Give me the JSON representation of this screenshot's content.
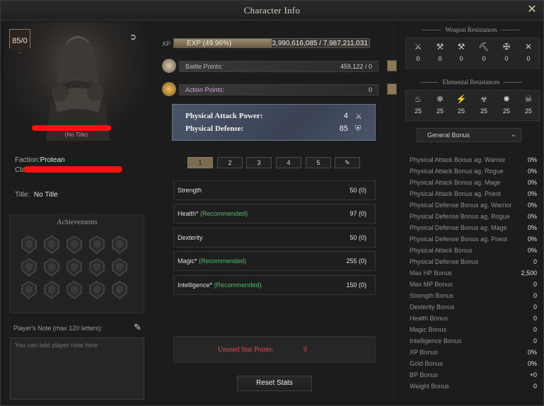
{
  "window": {
    "title": "Character Info"
  },
  "character": {
    "level": "85/0",
    "no_title": "(No Title)",
    "faction_label": "Faction:",
    "faction_value": "Protean",
    "clan_label": "Clan:",
    "title_label": "Title:",
    "title_value": "No Title"
  },
  "achievements": {
    "label": "Achievements",
    "count": 15
  },
  "note": {
    "label": "Player's Note (max 120 letters):",
    "placeholder": "You can add player note here"
  },
  "xp": {
    "label": "XP",
    "percent_label": "EXP (49.96%)",
    "value": "3,990,616,085 / 7,987,211,031",
    "fraction": 0.4996
  },
  "points": [
    {
      "label": "Battle Points:",
      "value": "459,122 / 0",
      "color": "#b8b8b8"
    },
    {
      "label": "Action Points:",
      "value": "0",
      "color": "#c8a4d8"
    }
  ],
  "power": [
    {
      "label": "Physical Attack Power:",
      "value": "4"
    },
    {
      "label": "Physical Defense:",
      "value": "85"
    }
  ],
  "tabs": [
    "1",
    "2",
    "3",
    "4",
    "5"
  ],
  "stats": [
    {
      "name": "Strength",
      "rec": "",
      "value": "50 (0)"
    },
    {
      "name": "Health*",
      "rec": "(Recommended)",
      "value": "97 (0)"
    },
    {
      "name": "Dexterity",
      "rec": "",
      "value": "50 (0)"
    },
    {
      "name": "Magic*",
      "rec": "(Recommended)",
      "value": "255 (0)"
    },
    {
      "name": "Intelligence*",
      "rec": "(Recommended)",
      "value": "150 (0)"
    }
  ],
  "unused": {
    "label": "Unused Stat Points:",
    "value": "0"
  },
  "reset_label": "Reset Stats",
  "weapon_resistances": {
    "title": "Weapon Resistances",
    "items": [
      {
        "icon": "crossed-swords-icon",
        "value": "0"
      },
      {
        "icon": "crossed-axes-icon",
        "value": "0"
      },
      {
        "icon": "hammer-icon",
        "value": "0"
      },
      {
        "icon": "crossed-picks-icon",
        "value": "0"
      },
      {
        "icon": "crossed-spears-icon",
        "value": "0"
      },
      {
        "icon": "crossed-daggers-icon",
        "value": "0"
      }
    ]
  },
  "elemental_resistances": {
    "title": "Elemental Resistances",
    "items": [
      {
        "icon": "fire-icon",
        "value": "25"
      },
      {
        "icon": "frost-icon",
        "value": "25"
      },
      {
        "icon": "lightning-icon",
        "value": "25"
      },
      {
        "icon": "poison-icon",
        "value": "25"
      },
      {
        "icon": "holy-icon",
        "value": "25"
      },
      {
        "icon": "dark-icon",
        "value": "25"
      }
    ]
  },
  "bonus": {
    "dropdown": "General Bonus",
    "rows": [
      {
        "label": "Physical Attack Bonus ag. Warrior",
        "value": "0%"
      },
      {
        "label": "Physical Attack Bonus ag. Rogue",
        "value": "0%"
      },
      {
        "label": "Physical Attack Bonus ag. Mage",
        "value": "0%"
      },
      {
        "label": "Physical Attack Bonus ag. Priest",
        "value": "0%"
      },
      {
        "label": "Physical Defense Bonus ag. Warrior",
        "value": "0%"
      },
      {
        "label": "Physical Defense Bonus ag. Rogue",
        "value": "0%"
      },
      {
        "label": "Physical Defense Bonus ag. Mage",
        "value": "0%"
      },
      {
        "label": "Physical Defense Bonus ag. Priest",
        "value": "0%"
      },
      {
        "label": "Physical Attack Bonus",
        "value": "0%"
      },
      {
        "label": "Physical Defense Bonus",
        "value": "0"
      },
      {
        "label": "Max HP Bonus",
        "value": "2,500"
      },
      {
        "label": "Max MP Bonus",
        "value": "0"
      },
      {
        "label": "Strength Bonus",
        "value": "0"
      },
      {
        "label": "Dexterity Bonus",
        "value": "0"
      },
      {
        "label": "Health Bonus",
        "value": "0"
      },
      {
        "label": "Magic Bonus",
        "value": "0"
      },
      {
        "label": "Intelligence Bonus",
        "value": "0"
      },
      {
        "label": "XP Bonus",
        "value": "0%"
      },
      {
        "label": "Gold Bonus",
        "value": "0%"
      },
      {
        "label": "BP Bonus",
        "value": "+0"
      },
      {
        "label": "Weight Bonus",
        "value": "0"
      }
    ]
  },
  "colors": {
    "accent": "#8c7c5c",
    "recommended": "#4fbf6d",
    "unused": "#e05050"
  }
}
